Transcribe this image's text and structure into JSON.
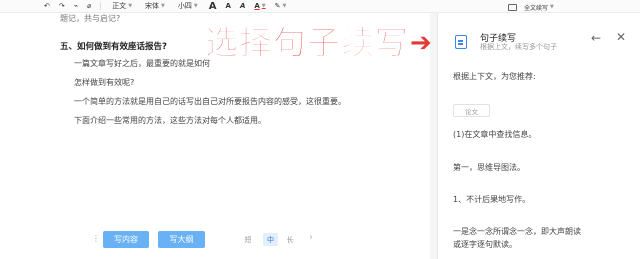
{
  "toolbar": {
    "undo": "↶",
    "redo": "↷",
    "clear_format": "⌀",
    "style_select": "正文",
    "font_select": "宋体",
    "size_select": "小四",
    "grow_font": "A",
    "shrink_font": "A",
    "text_effect": "A",
    "font_color": "A",
    "highlight": "✎",
    "right_select": "全文续写"
  },
  "document": {
    "top_fragment": "题记，共与启记?",
    "heading": "五、如何做到有效座话报告?",
    "paragraphs": [
      "一篇文章写好之后，最重要的就是如何",
      "怎样做到有效呢?",
      "一个简单的方法就是用自己的话写出自己对所要报告内容的感受，这很重要。",
      "下面介绍一些常用的方法，这些方法对每个人都适用。"
    ],
    "banner": "选择句子续写",
    "banner_arrow": "➔",
    "drag_handle": "⋮",
    "write_content_button": "写内容",
    "write_outline_button": "写大纲",
    "length_short": "短",
    "length_medium": "中",
    "length_long": "长",
    "length_next": "›"
  },
  "panel": {
    "title": "句子续写",
    "subtitle": "根据上文，续写多个句子",
    "back": "←",
    "close": "✕",
    "prompt": "根据上下文，为您推荐:",
    "tag": "论文",
    "results": [
      "(1)在文章中查找信息。",
      "第一，思维导图法。",
      "1、不计后果地写作。",
      "一是念一念所谓念一念，即大声朗读",
      "或逐字逐句默读。"
    ]
  },
  "colors": {
    "accent_blue": "#69b1f5",
    "banner_red": "#e53935"
  }
}
